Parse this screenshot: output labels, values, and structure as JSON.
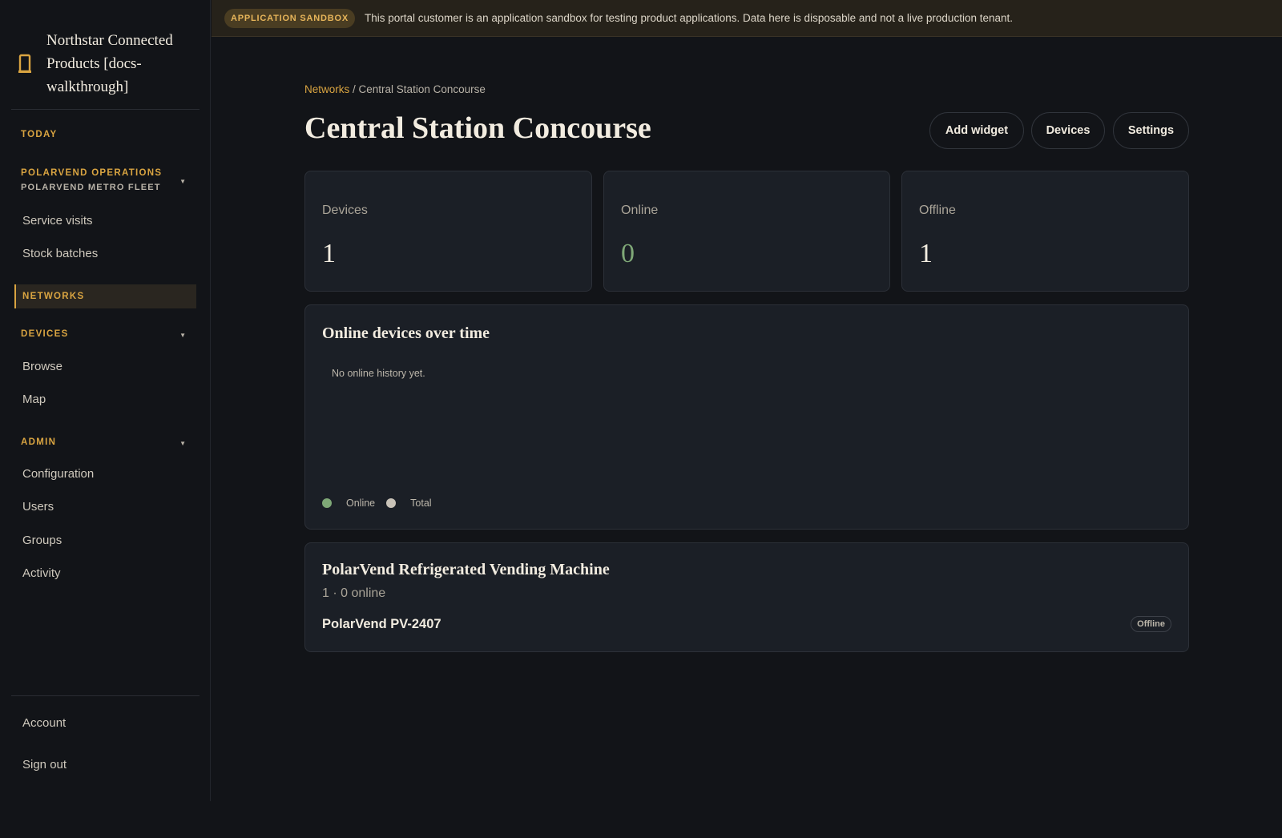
{
  "sidebar": {
    "brand": "Northstar Connected Products [docs-walkthrough]",
    "today": "TODAY",
    "org": "POLARVEND OPERATIONS",
    "fleet": "POLARVEND METRO FLEET",
    "org_items": [
      "Service visits",
      "Stock batches"
    ],
    "networks": "NETWORKS",
    "devices": "DEVICES",
    "devices_items": [
      "Browse",
      "Map"
    ],
    "admin": "ADMIN",
    "admin_items": [
      "Configuration",
      "Users",
      "Groups",
      "Activity"
    ],
    "account": "Account",
    "sign_out": "Sign out"
  },
  "banner": {
    "badge": "APPLICATION SANDBOX",
    "text": "This portal customer is an application sandbox for testing product applications. Data here is disposable and not a live production tenant."
  },
  "breadcrumb": {
    "root": "Networks",
    "separator": " / ",
    "current": "Central Station Concourse"
  },
  "page": {
    "title": "Central Station Concourse",
    "actions": [
      "Add widget",
      "Devices",
      "Settings"
    ]
  },
  "stats": [
    {
      "label": "Devices",
      "value": "1"
    },
    {
      "label": "Online",
      "value": "0"
    },
    {
      "label": "Offline",
      "value": "1"
    }
  ],
  "chart": {
    "title": "Online devices over time",
    "empty": "No online history yet.",
    "legend": [
      {
        "label": "Online",
        "color": "#7fa877"
      },
      {
        "label": "Total",
        "color": "#c9c3b8"
      }
    ]
  },
  "group": {
    "title": "PolarVend Refrigerated Vending Machine",
    "summary": "1 · 0 online",
    "device": "PolarVend PV-2407",
    "status": "Offline"
  },
  "colors": {
    "accent": "#d9a441",
    "online": "#7fa877"
  }
}
